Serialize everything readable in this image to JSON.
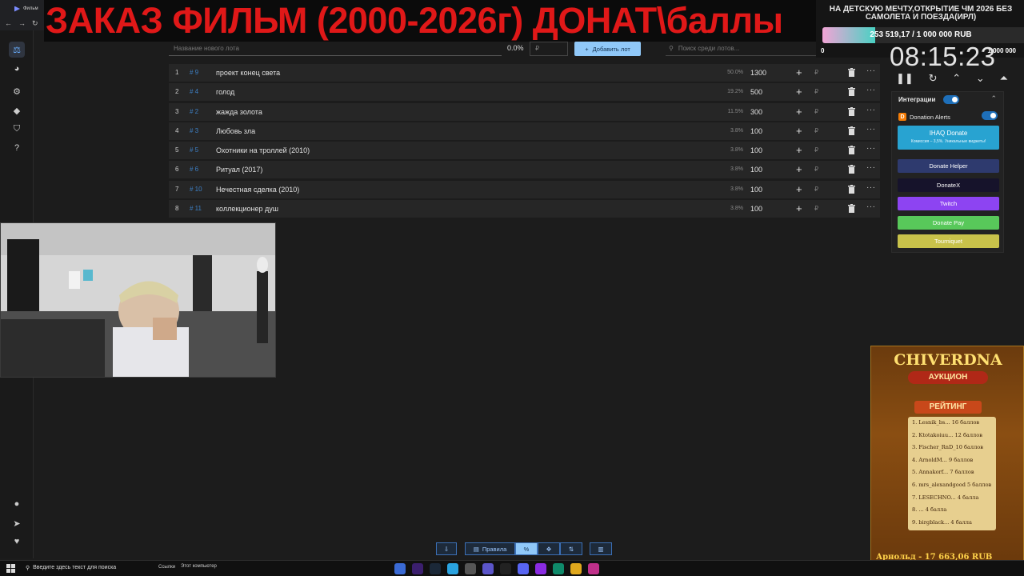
{
  "browser": {
    "tab_label": "Фильм"
  },
  "banner": {
    "text": "ЗАКАЗ ФИЛЬМ (2000-2026г) ДОНАТ\\баллы"
  },
  "new_lot": {
    "name_placeholder": "Название нового лота",
    "percent": "0.0%",
    "price_placeholder": "₽",
    "add_label": "Добавить лот",
    "search_placeholder": "Поиск среди лотов..."
  },
  "lots": [
    {
      "n": "1",
      "id": "# 9",
      "name": "проект конец света",
      "percent": "50.0%",
      "amount": "1300"
    },
    {
      "n": "2",
      "id": "# 4",
      "name": "голод",
      "percent": "19.2%",
      "amount": "500"
    },
    {
      "n": "3",
      "id": "# 2",
      "name": "жажда золота",
      "percent": "11.5%",
      "amount": "300"
    },
    {
      "n": "4",
      "id": "# 3",
      "name": "Любовь зла",
      "percent": "3.8%",
      "amount": "100"
    },
    {
      "n": "5",
      "id": "# 5",
      "name": "Охотники на троллей (2010)",
      "percent": "3.8%",
      "amount": "100"
    },
    {
      "n": "6",
      "id": "# 6",
      "name": "Ритуал (2017)",
      "percent": "3.8%",
      "amount": "100"
    },
    {
      "n": "7",
      "id": "# 10",
      "name": " Нечестная сделка (2010)",
      "percent": "3.8%",
      "amount": "100"
    },
    {
      "n": "8",
      "id": "# 11",
      "name": "коллекционер душ",
      "percent": "3.8%",
      "amount": "100"
    }
  ],
  "currency": "₽",
  "goal": {
    "title": "НА ДЕТСКУЮ МЕЧТУ,ОТКРЫТИЕ ЧМ 2026 БЕЗ САМОЛЕТА И ПОЕЗДА(ИРЛ)",
    "progress_text": "253 519,17 / 1 000 000 RUB",
    "progress_fraction": 0.2535,
    "min": "0",
    "max": "1 000 000"
  },
  "timer": "08:15:23",
  "integrations": {
    "header": "Интеграции",
    "donation_alerts": "Donation Alerts",
    "ihaq_title": "IHAQ Donate",
    "ihaq_sub": "Комиссия – 3,5%. Уникальные виджеты!",
    "services": [
      {
        "label": "Donate Helper",
        "color": "#2e3a6e"
      },
      {
        "label": "DonateX",
        "color": "#16132b"
      },
      {
        "label": "Twitch",
        "color": "#8d44f2"
      },
      {
        "label": "Donate Pay",
        "color": "#58c85a"
      },
      {
        "label": "Tourniquet",
        "color": "#c8c24a"
      }
    ]
  },
  "poster": {
    "brand": "CHIVERDNA",
    "auction": "АУКЦИОН",
    "rating": "РЕЙТИНГ",
    "rows": [
      "1. Lesnik_bs... 16 баллов",
      "2. Ktotakoiuu... 12 баллов",
      "3. Fischer_RnD_10 баллов",
      "4. ArnoldM... 9 баллов",
      "5. Annakorf... 7 баллов",
      "6. mrs_alexandgood 5 баллов",
      "7. LESECHNO... 4 балла",
      "8. ... 4 балла",
      "9. birgblack... 4 балла"
    ],
    "footer": "Арнольд - 17 663,06 RUB"
  },
  "toolbar": {
    "rules": "Правила"
  },
  "taskbar": {
    "search": "Введите здесь текст для поиска",
    "links": "Ссылки",
    "pc": "Этот компьютер"
  }
}
